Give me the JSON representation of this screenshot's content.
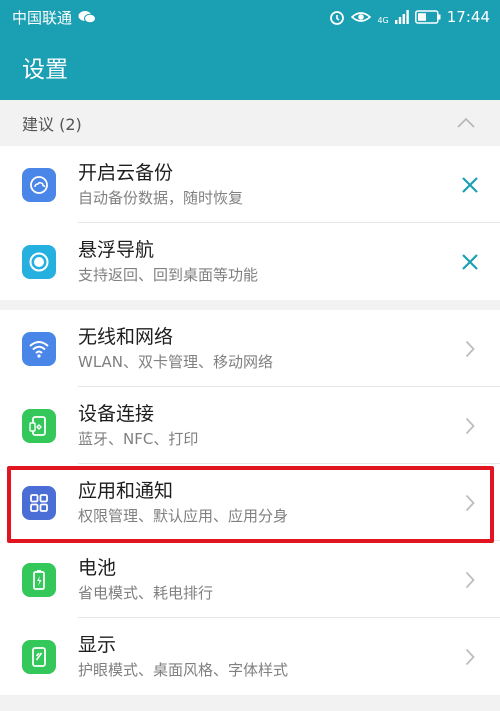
{
  "status_bar": {
    "carrier": "中国联通",
    "network_label": "4G",
    "time": "17:44",
    "icons": [
      "wechat-icon",
      "alarm-icon",
      "eye-icon",
      "signal-icon",
      "battery-icon"
    ]
  },
  "app_bar": {
    "title": "设置"
  },
  "suggestions": {
    "header": "建议 (2)",
    "items": [
      {
        "title": "开启云备份",
        "subtitle": "自动备份数据，随时恢复",
        "icon": "cloud-backup-icon",
        "color": "#4a86e8"
      },
      {
        "title": "悬浮导航",
        "subtitle": "支持返回、回到桌面等功能",
        "icon": "floating-dock-icon",
        "color": "#26b0e0"
      }
    ]
  },
  "settings": {
    "items": [
      {
        "title": "无线和网络",
        "subtitle": "WLAN、双卡管理、移动网络",
        "icon": "wifi-icon",
        "color": "#4a86e8"
      },
      {
        "title": "设备连接",
        "subtitle": "蓝牙、NFC、打印",
        "icon": "device-connection-icon",
        "color": "#34c759"
      },
      {
        "title": "应用和通知",
        "subtitle": "权限管理、默认应用、应用分身",
        "icon": "apps-icon",
        "color": "#4a6ed6"
      },
      {
        "title": "电池",
        "subtitle": "省电模式、耗电排行",
        "icon": "battery-icon",
        "color": "#34c759"
      },
      {
        "title": "显示",
        "subtitle": "护眼模式、桌面风格、字体样式",
        "icon": "display-icon",
        "color": "#34c759"
      }
    ]
  },
  "colors": {
    "accent": "#1a9fb3",
    "highlight": "#e0151f",
    "dismiss": "#1a9fb3"
  }
}
